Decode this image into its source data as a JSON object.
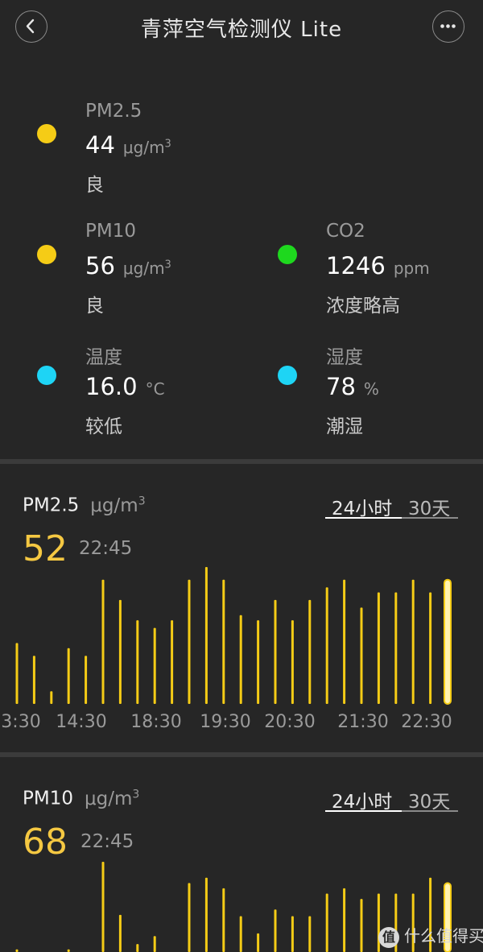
{
  "header": {
    "title": "青萍空气检测仪 Lite"
  },
  "metrics": {
    "pm25": {
      "label": "PM2.5",
      "value": "44",
      "unit": "μg/m",
      "unit_sup": "3",
      "status": "良",
      "dot_color": "#f5cc16"
    },
    "pm10": {
      "label": "PM10",
      "value": "56",
      "unit": "μg/m",
      "unit_sup": "3",
      "status": "良",
      "dot_color": "#f5cc16"
    },
    "co2": {
      "label": "CO2",
      "value": "1246",
      "unit": "ppm",
      "status": "浓度略高",
      "dot_color": "#1ed81e"
    },
    "temp": {
      "label": "温度",
      "value": "16.0",
      "unit": "°C",
      "status": "较低",
      "dot_color": "#1ed4f5"
    },
    "hum": {
      "label": "湿度",
      "value": "78",
      "unit": "%",
      "status": "潮湿",
      "dot_color": "#1ed4f5"
    }
  },
  "pm25_panel": {
    "title": "PM2.5",
    "unit": "μg/m",
    "unit_sup": "3",
    "tab_24h": "24小时",
    "tab_30d": "30天",
    "value": "52",
    "time": "22:45"
  },
  "pm10_panel": {
    "title": "PM10",
    "unit": "μg/m",
    "unit_sup": "3",
    "tab_24h": "24小时",
    "tab_30d": "30天",
    "value": "68",
    "time": "22:45"
  },
  "colors": {
    "accent": "#f5c842",
    "bar": "#f5cc16",
    "selected_bar": "#fff3b0"
  },
  "chart_data": [
    {
      "type": "bar",
      "title": "PM2.5",
      "ylabel": "μg/m3",
      "ylim": [
        0,
        54
      ],
      "values": [
        24,
        19,
        5,
        22,
        19,
        49,
        41,
        33,
        30,
        33,
        49,
        54,
        49,
        35,
        33,
        41,
        33,
        41,
        46,
        49,
        38,
        44,
        44,
        49,
        44,
        49
      ],
      "selected_index": 25,
      "tick_labels": [
        "3:30",
        "14:30",
        "18:30",
        "19:30",
        "20:30",
        "21:30",
        "22:30"
      ]
    },
    {
      "type": "bar",
      "title": "PM10",
      "ylabel": "μg/m3",
      "ylim": [
        0,
        68
      ],
      "values": [
        2,
        0,
        0,
        2,
        0,
        68,
        28,
        6,
        12,
        0,
        52,
        56,
        48,
        27,
        14,
        32,
        27,
        27,
        44,
        48,
        40,
        44,
        44,
        44,
        56,
        52
      ],
      "selected_index": 25,
      "tick_labels": []
    }
  ],
  "watermark": {
    "icon": "值",
    "text": "什么值得买"
  }
}
